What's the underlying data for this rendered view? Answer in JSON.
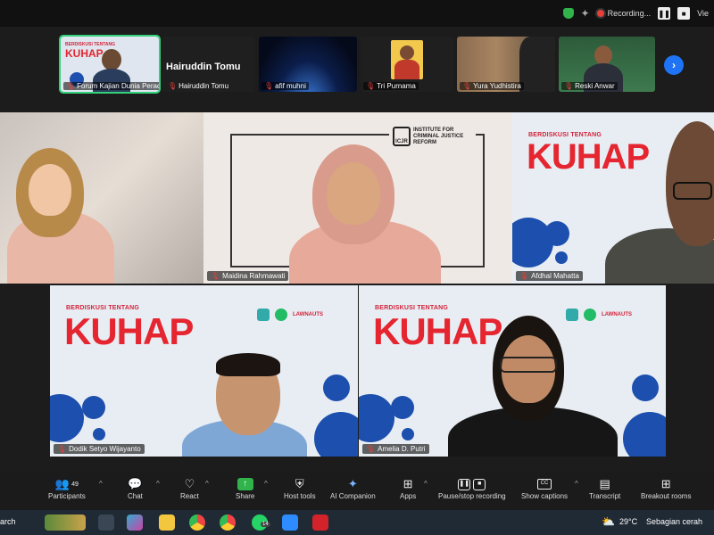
{
  "topbar": {
    "recording_label": "Recording...",
    "view_label": "Vie"
  },
  "filmstrip": [
    {
      "name": "Forum Kajian Dunia Perad...",
      "active": true
    },
    {
      "name": "Hairuddin Tomu",
      "display_name": "Hairuddin Tomu"
    },
    {
      "name": "afif muhni"
    },
    {
      "name": "Tri Purnama"
    },
    {
      "name": "Yura Yudhistira"
    },
    {
      "name": "Reski Anwar"
    }
  ],
  "gallery": [
    {
      "name": ""
    },
    {
      "name": "Maidina Rahmawati",
      "logo_text": "INSTITUTE FOR CRIMINAL JUSTICE REFORM",
      "logo_abbr": "ICJR"
    },
    {
      "name": "Afdhal Mahatta"
    },
    {
      "name": "Dodik Setyo Wijayanto"
    },
    {
      "name": "Amelia D. Putri"
    }
  ],
  "banner": {
    "pre": "BERDISKUSI TENTANG",
    "title": "KUHAP",
    "sponsor": "LAWNAUTS"
  },
  "toolbar": {
    "participants_label": "Participants",
    "participants_count": "49",
    "chat_label": "Chat",
    "react_label": "React",
    "share_label": "Share",
    "host_tools_label": "Host tools",
    "ai_label": "AI Companion",
    "apps_label": "Apps",
    "record_label": "Pause/stop recording",
    "captions_label": "Show captions",
    "transcript_label": "Transcript",
    "breakout_label": "Breakout rooms"
  },
  "taskbar": {
    "search_label": "arch",
    "temperature": "29°C",
    "weather": "Sebagian cerah",
    "badge": "14"
  },
  "colors": {
    "accent_green": "#34d17a",
    "zoom_blue": "#1e74f5",
    "kuhap_red": "#e5252f",
    "blob_blue": "#1c4fae"
  }
}
